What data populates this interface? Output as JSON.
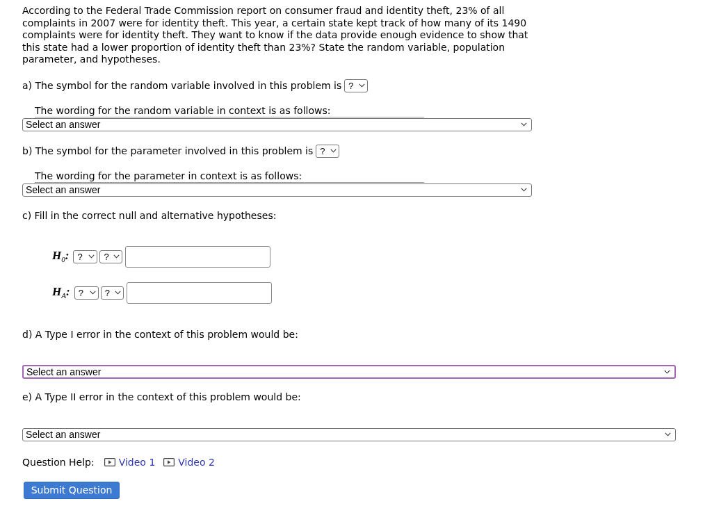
{
  "question": {
    "text": "According to the Federal Trade Commission report on consumer fraud and identity theft, 23% of all complaints in 2007 were for identity theft. This year, a certain state kept track of how many of its 1490 complaints were for identity theft. They want to know if the data provide enough evidence to show that this state had a lower proportion of identity theft than 23%? State the random variable, population parameter, and hypotheses."
  },
  "parts": [
    {
      "kind": "symbol",
      "prompt": "a) The symbol for the random variable involved in this problem is",
      "symbol_dropdown": "?",
      "wording_label": "The wording for the random variable in context is as follows:",
      "wording_dropdown": {
        "value": "Select an answer",
        "focused": false
      }
    },
    {
      "kind": "symbol",
      "prompt": "b) The symbol for the parameter involved in this problem is",
      "symbol_dropdown": "?",
      "wording_label": "The wording for the parameter in context is as follows:",
      "wording_dropdown": {
        "value": "Select an answer",
        "focused": false
      }
    },
    {
      "kind": "hypotheses",
      "prompt": "c) Fill in the correct null and alternative hypotheses:",
      "rows": [
        {
          "label": "H$_{0}$:",
          "dropdowns": [
            "?",
            "?"
          ]
        },
        {
          "label": "H$_{A}$:",
          "dropdowns": [
            "?",
            "?"
          ]
        }
      ]
    },
    {
      "kind": "error",
      "prompt": "d) A Type I error in the context of this problem would be:",
      "wording_dropdown": {
        "value": "Select an answer",
        "focused": true
      }
    },
    {
      "kind": "error",
      "prompt": "e) A Type II error in the context of this problem would be:",
      "wording_dropdown": {
        "value": "Select an answer",
        "focused": false
      }
    }
  ],
  "help": {
    "label": "Question Help:",
    "links": [
      "Video 1",
      "Video 2"
    ]
  },
  "submit_button": "Submit Question"
}
